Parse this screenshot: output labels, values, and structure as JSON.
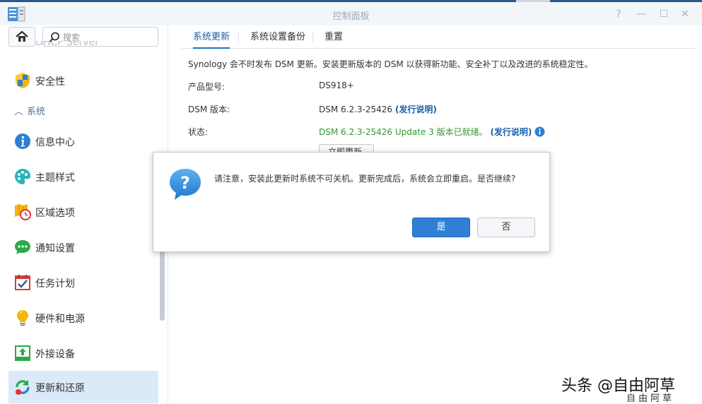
{
  "window": {
    "title": "控制面板"
  },
  "sidebar": {
    "search_placeholder": "搜索",
    "cut_item_label": "DHCP Server",
    "section_label": "系统",
    "items": [
      {
        "label": "安全性",
        "icon": "shield-icon"
      },
      {
        "label": "信息中心",
        "icon": "info-circle-icon"
      },
      {
        "label": "主题样式",
        "icon": "palette-icon"
      },
      {
        "label": "区域选项",
        "icon": "map-clock-icon"
      },
      {
        "label": "通知设置",
        "icon": "chat-bubble-icon"
      },
      {
        "label": "任务计划",
        "icon": "calendar-check-icon"
      },
      {
        "label": "硬件和电源",
        "icon": "lightbulb-icon"
      },
      {
        "label": "外接设备",
        "icon": "upload-device-icon"
      },
      {
        "label": "更新和还原",
        "icon": "refresh-icon"
      }
    ]
  },
  "tabs": [
    {
      "label": "系统更新"
    },
    {
      "label": "系统设置备份"
    },
    {
      "label": "重置"
    }
  ],
  "main": {
    "description": "Synology 会不时发布 DSM 更新。安装更新版本的 DSM 以获得新功能、安全补丁以及改进的系统稳定性。",
    "model_label": "产品型号:",
    "model_value": "DS918+",
    "dsm_label": "DSM 版本:",
    "dsm_value": "DSM 6.2.3-25426",
    "release_notes": "(发行说明)",
    "status_label": "状态:",
    "status_value": "DSM 6.2.3-25426 Update 3 版本已就绪。",
    "status_release_notes": "(发行说明)",
    "update_button": "立即更新"
  },
  "dialog": {
    "message": "请注意，安装此更新时系统不可关机。更新完成后，系统会立即重启。是否继续?",
    "yes_label": "是",
    "no_label": "否"
  },
  "watermark": {
    "text": "头条 @自由阿草",
    "small": "自由阿草"
  },
  "colors": {
    "accent": "#2f7fd6",
    "status_green": "#2e9a2e",
    "link": "#1a5fa8"
  }
}
